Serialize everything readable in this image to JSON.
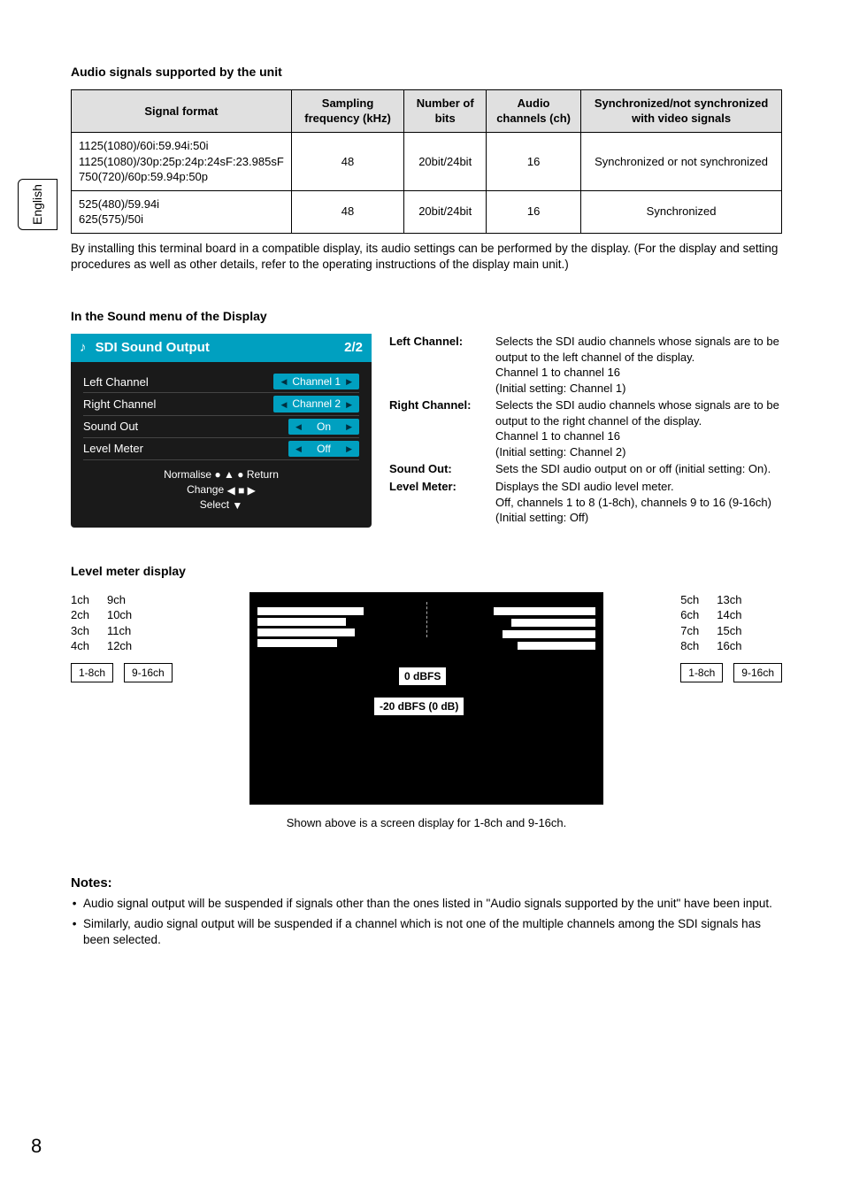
{
  "language_tab": "English",
  "page_number": "8",
  "audio_signals_heading": "Audio signals supported by the unit",
  "sig_table": {
    "headers": [
      "Signal format",
      "Sampling frequency (kHz)",
      "Number of bits",
      "Audio channels (ch)",
      "Synchronized/not synchronized with video signals"
    ],
    "rows": [
      {
        "fmt": "1125(1080)/60i:59.94i:50i\n1125(1080)/30p:25p:24p:24sF:23.985sF\n750(720)/60p:59.94p:50p",
        "freq": "48",
        "bits": "20bit/24bit",
        "ch": "16",
        "sync": "Synchronized or not synchronized"
      },
      {
        "fmt": "525(480)/59.94i\n625(575)/50i",
        "freq": "48",
        "bits": "20bit/24bit",
        "ch": "16",
        "sync": "Synchronized"
      }
    ]
  },
  "install_note": "By installing this terminal board in a compatible display, its audio settings can be performed by the display. (For the display and setting procedures as well as other details, refer to the operating instructions of the display main unit.)",
  "sound_menu_heading": "In the Sound menu of the Display",
  "osd": {
    "title": "SDI Sound Output",
    "page": "2/2",
    "items": [
      {
        "label": "Left Channel",
        "value": "Channel 1"
      },
      {
        "label": "Right Channel",
        "value": "Channel 2"
      },
      {
        "label": "Sound Out",
        "value": "On"
      },
      {
        "label": "Level Meter",
        "value": "Off"
      }
    ],
    "footer": {
      "normalise": "Normalise",
      "return": "Return",
      "change": "Change",
      "select": "Select"
    }
  },
  "definitions": [
    {
      "label": "Left Channel:",
      "text": "Selects the SDI audio channels whose signals are to be output to the left channel of the display.\nChannel 1 to channel 16\n(Initial setting: Channel 1)"
    },
    {
      "label": "Right Channel:",
      "text": "Selects the SDI audio channels whose signals are to be output to the right channel of the display.\nChannel 1 to channel 16\n(Initial setting: Channel 2)"
    },
    {
      "label": "Sound Out:",
      "text": "Sets the SDI audio output on or off (initial setting: On)."
    },
    {
      "label": "Level Meter:",
      "text": "Displays the SDI audio level meter.\nOff, channels 1 to 8 (1-8ch), channels 9 to 16 (9-16ch)\n(Initial setting: Off)"
    }
  ],
  "level_meter_heading": "Level meter display",
  "left_channels": {
    "colA": [
      "1ch",
      "2ch",
      "3ch",
      "4ch"
    ],
    "colB": [
      "9ch",
      "10ch",
      "11ch",
      "12ch"
    ],
    "btnA": "1-8ch",
    "btnB": "9-16ch"
  },
  "right_channels": {
    "colA": [
      "5ch",
      "6ch",
      "7ch",
      "8ch"
    ],
    "colB": [
      "13ch",
      "14ch",
      "15ch",
      "16ch"
    ],
    "btnA": "1-8ch",
    "btnB": "9-16ch"
  },
  "meter_labels": {
    "zero": "0 dBFS",
    "minus20": "-20 dBFS (0 dB)"
  },
  "meter_caption": "Shown above is a screen display for 1-8ch and 9-16ch.",
  "notes_heading": "Notes:",
  "notes": [
    "Audio signal output will be suspended if signals other than the ones listed in \"Audio signals supported by the unit\" have been input.",
    "Similarly, audio signal output will be suspended if a channel which is not one of the multiple channels among the SDI signals has been selected."
  ]
}
